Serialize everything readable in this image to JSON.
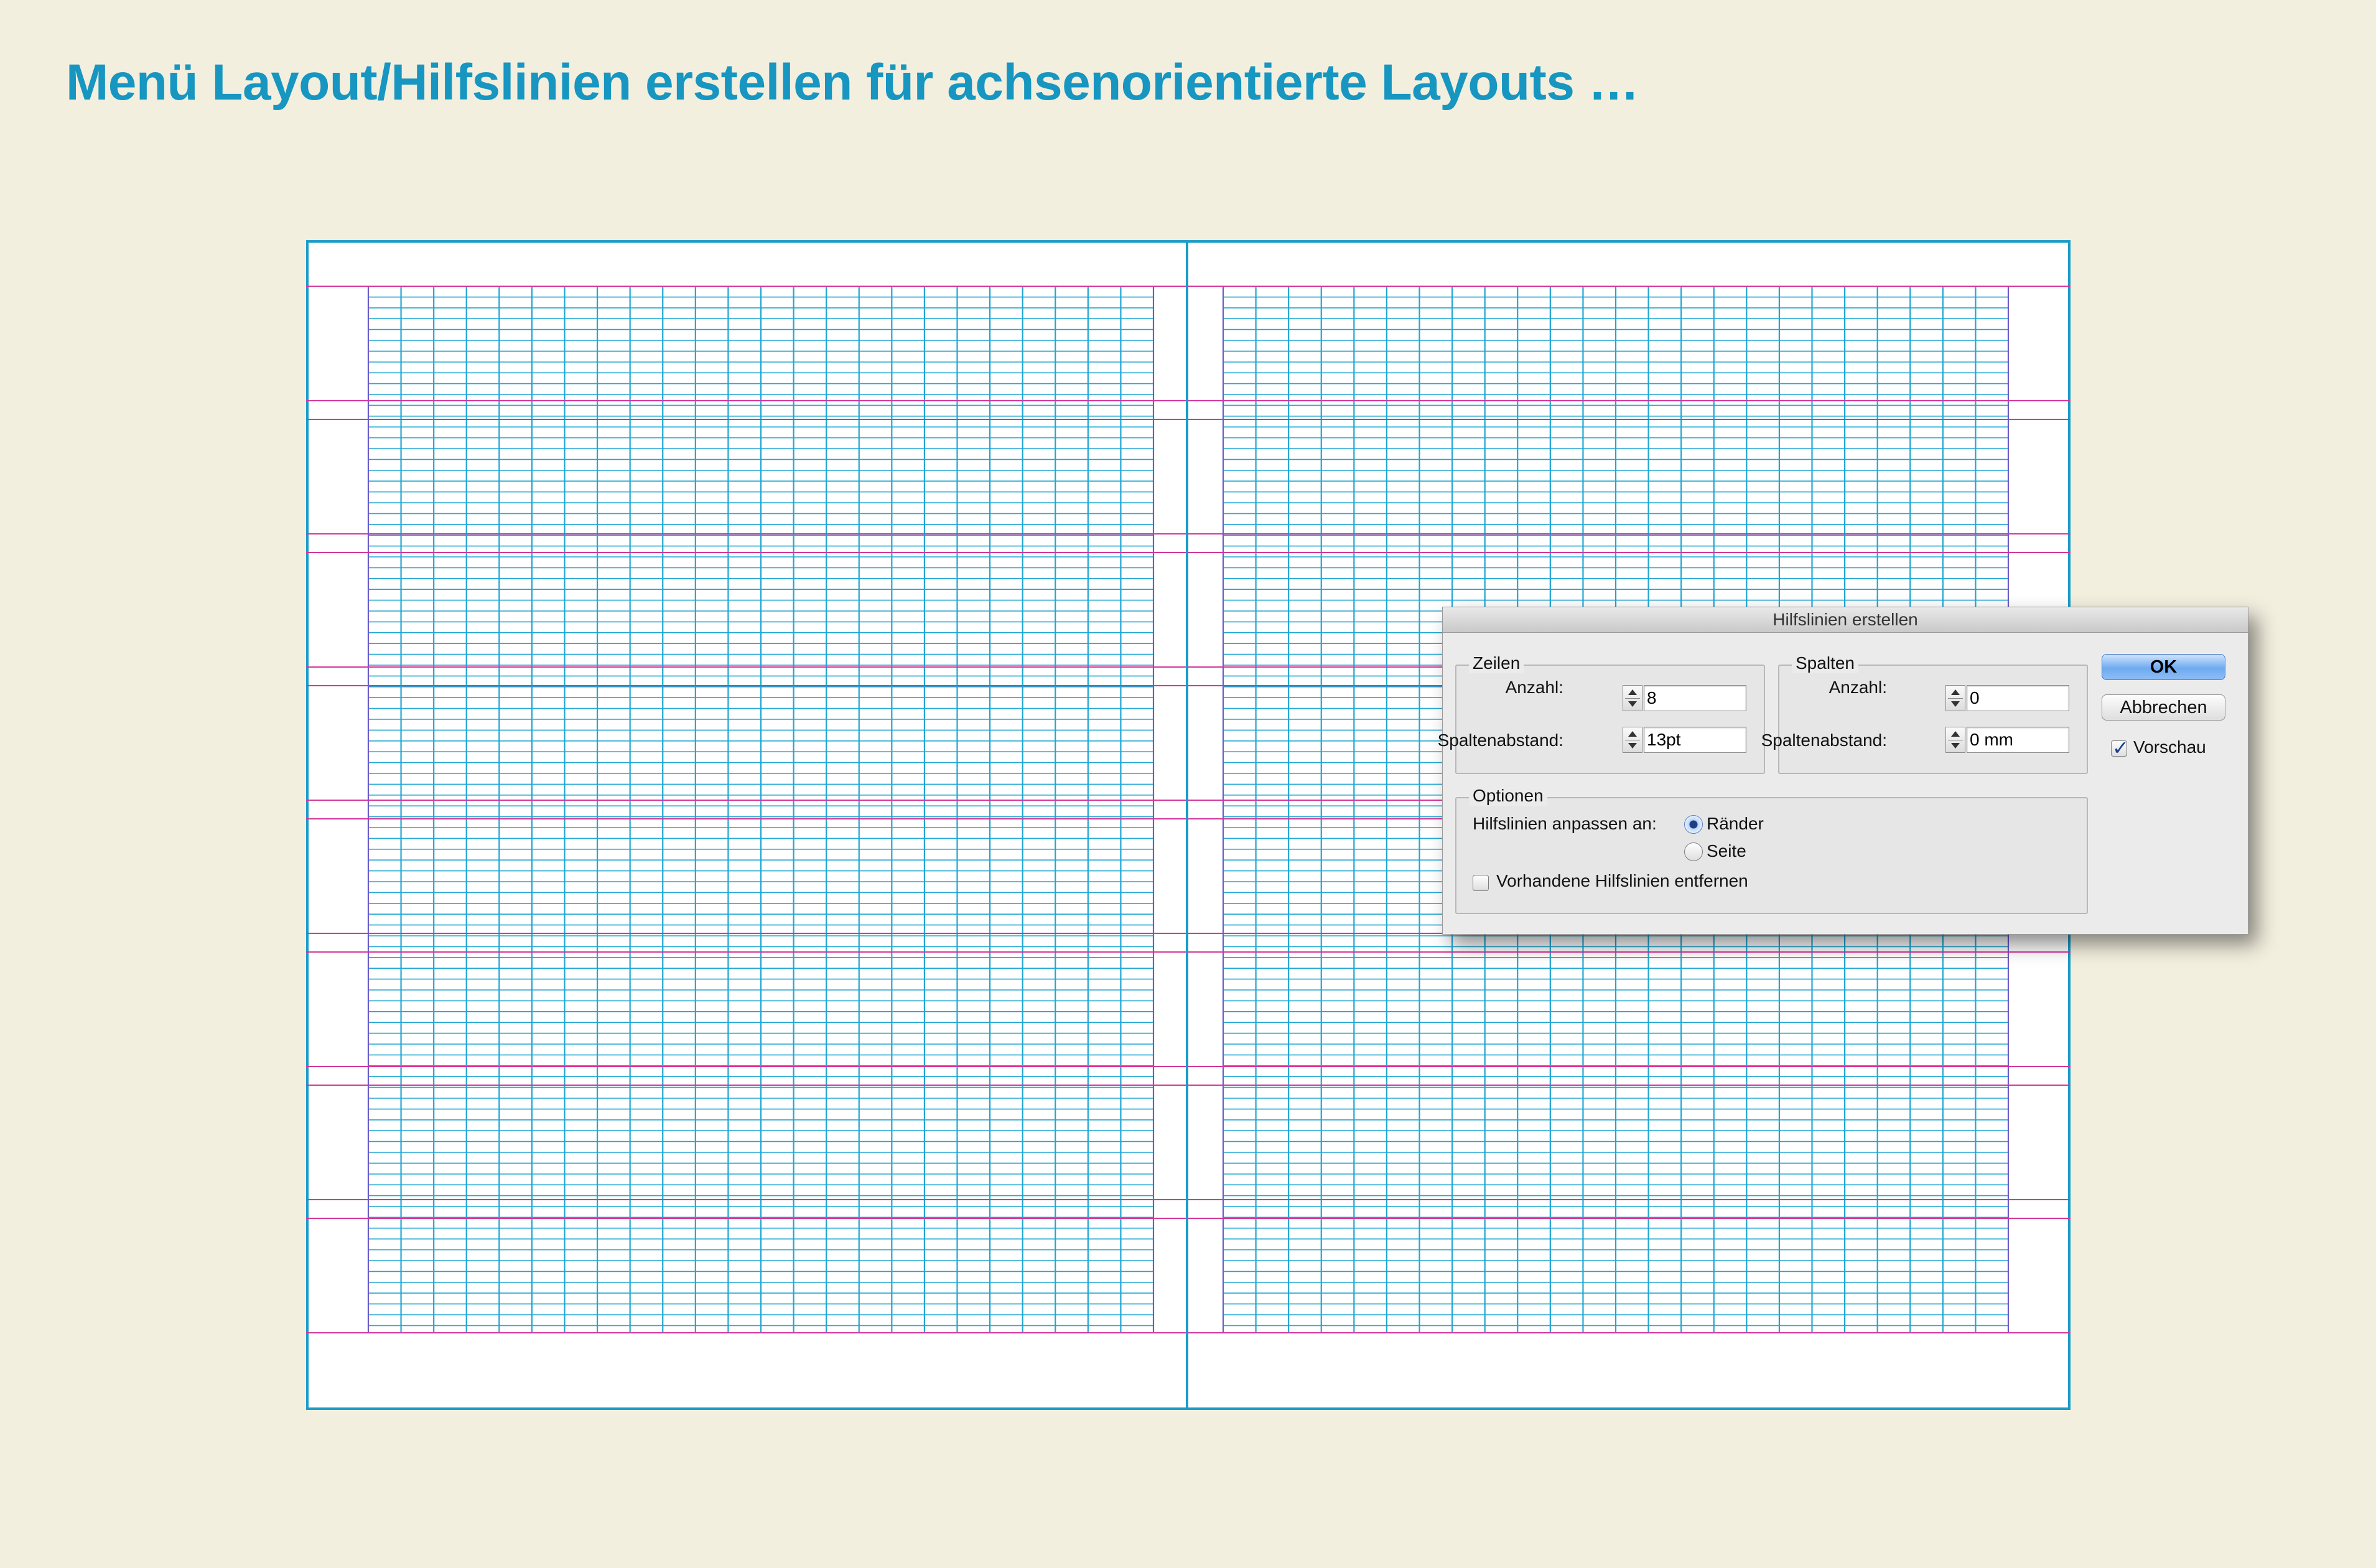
{
  "headline": "Menü Layout/Hilfslinien erstellen für achsenorientierte Layouts …",
  "colors": {
    "background": "#f3efdf",
    "accent": "#1696c0",
    "page_border": "#1a9cc9",
    "guide_magenta": "#d4379b",
    "grid_cyan": "#21a6d2",
    "grid_violet": "#6b5cc9"
  },
  "dialog": {
    "title": "Hilfslinien erstellen",
    "zeilen": {
      "legend": "Zeilen",
      "anzahl_label": "Anzahl:",
      "anzahl_value": "8",
      "abstand_label": "Spaltenabstand:",
      "abstand_value": "13pt"
    },
    "spalten": {
      "legend": "Spalten",
      "anzahl_label": "Anzahl:",
      "anzahl_value": "0",
      "abstand_label": "Spaltenabstand:",
      "abstand_value": "0 mm"
    },
    "ok_label": "OK",
    "cancel_label": "Abbrechen",
    "preview_label": "Vorschau",
    "preview_checked": true,
    "optionen": {
      "legend": "Optionen",
      "fit_label": "Hilfslinien anpassen an:",
      "fit_options": [
        "Ränder",
        "Seite"
      ],
      "fit_selected": "Ränder",
      "remove_label": "Vorhandene Hilfslinien entfernen",
      "remove_checked": false
    }
  }
}
